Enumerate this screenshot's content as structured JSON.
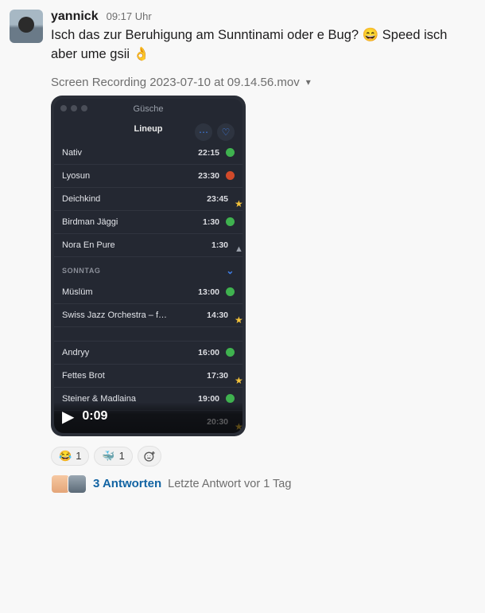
{
  "message": {
    "username": "yannick",
    "timestamp": "09:17 Uhr",
    "body": "Isch das zur Beruhigung am Sunntinami oder e Bug? 😄 Speed isch aber ume gsii 👌",
    "attachment_label": "Screen Recording 2023-07-10 at 09.14.56.mov"
  },
  "app": {
    "title": "Güsche",
    "tab_label": "Lineup",
    "section_sonntag": "SONNTAG",
    "rows_top": [
      {
        "name": "Nativ",
        "time": "22:15",
        "marker": "green"
      },
      {
        "name": "Lyosun",
        "time": "23:30",
        "marker": "red"
      },
      {
        "name": "Deichkind",
        "time": "23:45",
        "marker": "star"
      },
      {
        "name": "Birdman Jäggi",
        "time": "1:30",
        "marker": "green"
      },
      {
        "name": "Nora En Pure",
        "time": "1:30",
        "marker": "warn"
      }
    ],
    "rows_sonntag": [
      {
        "name": "Müslüm",
        "time": "13:00",
        "marker": "green"
      },
      {
        "name": "Swiss Jazz Orchestra – feat",
        "time": "14:30",
        "marker": "star"
      }
    ],
    "rows_after_gap": [
      {
        "name": "Andryy",
        "time": "16:00",
        "marker": "green"
      },
      {
        "name": "Fettes Brot",
        "time": "17:30",
        "marker": "star"
      },
      {
        "name": "Steiner & Madlaina",
        "time": "19:00",
        "marker": "green"
      }
    ],
    "last_row": {
      "name": "",
      "time": "20:30",
      "marker": "star"
    }
  },
  "video": {
    "current_time": "0:09"
  },
  "reactions": {
    "laugh": {
      "emoji": "😂",
      "count": "1"
    },
    "whale": {
      "emoji": "🐳",
      "count": "1"
    }
  },
  "replies": {
    "count_label": "3 Antworten",
    "meta": "Letzte Antwort vor 1 Tag"
  }
}
